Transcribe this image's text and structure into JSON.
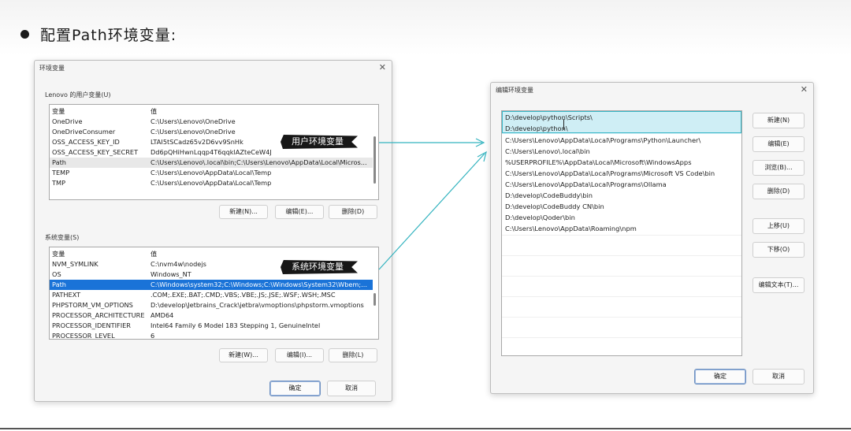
{
  "slide": {
    "heading": "配置Path环境变量:"
  },
  "env_dialog": {
    "title": "环境变量",
    "user_group_label": "Lenovo 的用户变量(U)",
    "user_header": {
      "name": "变量",
      "value": "值"
    },
    "user_vars": [
      {
        "name": "OneDrive",
        "value": "C:\\Users\\Lenovo\\OneDrive"
      },
      {
        "name": "OneDriveConsumer",
        "value": "C:\\Users\\Lenovo\\OneDrive"
      },
      {
        "name": "OSS_ACCESS_KEY_ID",
        "value": "LTAI5tSCadz65v2D6vv9SnHk"
      },
      {
        "name": "OSS_ACCESS_KEY_SECRET",
        "value": "Dd6pQHiHwnLqqp4T6qqklAZteCeW4J"
      },
      {
        "name": "Path",
        "value": "C:\\Users\\Lenovo\\.local\\bin;C:\\Users\\Lenovo\\AppData\\Local\\Micros..."
      },
      {
        "name": "TEMP",
        "value": "C:\\Users\\Lenovo\\AppData\\Local\\Temp"
      },
      {
        "name": "TMP",
        "value": "C:\\Users\\Lenovo\\AppData\\Local\\Temp"
      }
    ],
    "user_buttons": {
      "new": "新建(N)...",
      "edit": "编辑(E)...",
      "delete": "删除(D)"
    },
    "sys_group_label": "系统变量(S)",
    "sys_header": {
      "name": "变量",
      "value": "值"
    },
    "sys_vars": [
      {
        "name": "NVM_SYMLINK",
        "value": "C:\\nvm4w\\nodejs"
      },
      {
        "name": "OS",
        "value": "Windows_NT"
      },
      {
        "name": "Path",
        "value": "C:\\Windows\\system32;C:\\Windows;C:\\Windows\\System32\\Wbem;..."
      },
      {
        "name": "PATHEXT",
        "value": ".COM;.EXE;.BAT;.CMD;.VBS;.VBE;.JS;.JSE;.WSF;.WSH;.MSC"
      },
      {
        "name": "PHPSTORM_VM_OPTIONS",
        "value": "D:\\develop\\Jetbrains_Crack\\jetbra\\vmoptions\\phpstorm.vmoptions"
      },
      {
        "name": "PROCESSOR_ARCHITECTURE",
        "value": "AMD64"
      },
      {
        "name": "PROCESSOR_IDENTIFIER",
        "value": "Intel64 Family 6 Model 183 Stepping 1, GenuineIntel"
      },
      {
        "name": "PROCESSOR_LEVEL",
        "value": "6"
      }
    ],
    "sys_buttons": {
      "new": "新建(W)...",
      "edit": "编辑(I)...",
      "delete": "删除(L)"
    },
    "ok": "确定",
    "cancel": "取消"
  },
  "callouts": {
    "user": "用户环境变量",
    "system": "系统环境变量"
  },
  "edit_dialog": {
    "title": "编辑环境变量",
    "entries": [
      "D:\\develop\\python\\Scripts\\",
      "D:\\develop\\python\\",
      "C:\\Users\\Lenovo\\AppData\\Local\\Programs\\Python\\Launcher\\",
      "C:\\Users\\Lenovo\\.local\\bin",
      "%USERPROFILE%\\AppData\\Local\\Microsoft\\WindowsApps",
      "C:\\Users\\Lenovo\\AppData\\Local\\Programs\\Microsoft VS Code\\bin",
      "C:\\Users\\Lenovo\\AppData\\Local\\Programs\\Ollama",
      "D:\\develop\\CodeBuddy\\bin",
      "D:\\develop\\CodeBuddy CN\\bin",
      "D:\\develop\\Qoder\\bin",
      "C:\\Users\\Lenovo\\AppData\\Roaming\\npm"
    ],
    "buttons": {
      "new": "新建(N)",
      "edit": "编辑(E)",
      "browse": "浏览(B)...",
      "delete": "删除(D)",
      "move_up": "上移(U)",
      "move_down": "下移(O)",
      "edit_text": "编辑文本(T)..."
    },
    "ok": "确定",
    "cancel": "取消"
  },
  "colors": {
    "selection_blue": "#1a73d8",
    "selection_teal_frame": "#3ab8c8",
    "arrow_teal": "#33b3bf",
    "callout_bg": "#171717"
  }
}
